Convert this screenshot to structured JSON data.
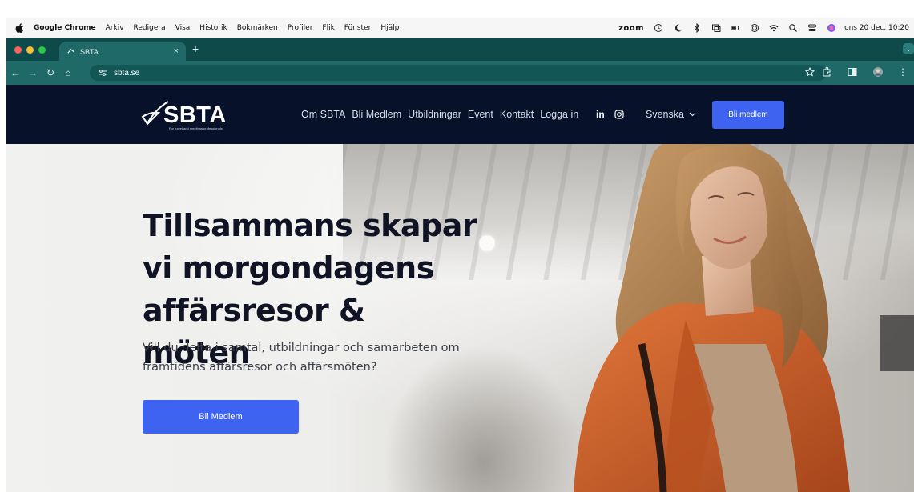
{
  "menubar": {
    "app_name": "Google Chrome",
    "items": [
      "Arkiv",
      "Redigera",
      "Visa",
      "Historik",
      "Bokmärken",
      "Profiler",
      "Flik",
      "Fönster",
      "Hjälp"
    ],
    "zoom": "zoom",
    "clock": "ons 20 dec. 10:20"
  },
  "browser": {
    "tab_title": "SBTA",
    "url": "sbta.se"
  },
  "site": {
    "logo_text": "SBTA",
    "logo_tagline": "For travel and meetings professionals",
    "nav": [
      "Om SBTA",
      "Bli Medlem",
      "Utbildningar",
      "Event",
      "Kontakt",
      "Logga in"
    ],
    "linkedin": "in",
    "language": "Svenska",
    "cta_top": "Bli medlem",
    "hero": {
      "title": "Tillsammans skapar vi morgondagens affärsresor & möten",
      "subtitle": "Vill du delta i samtal, utbildningar och samarbeten om framtidens affärsresor och affärsmöten?",
      "cta": "Bli Medlem"
    }
  },
  "colors": {
    "nav_bg": "#07112a",
    "accent_blue": "#3d63f0",
    "chrome_teal": "#1f6a68",
    "jacket_orange": "#c85a22"
  }
}
